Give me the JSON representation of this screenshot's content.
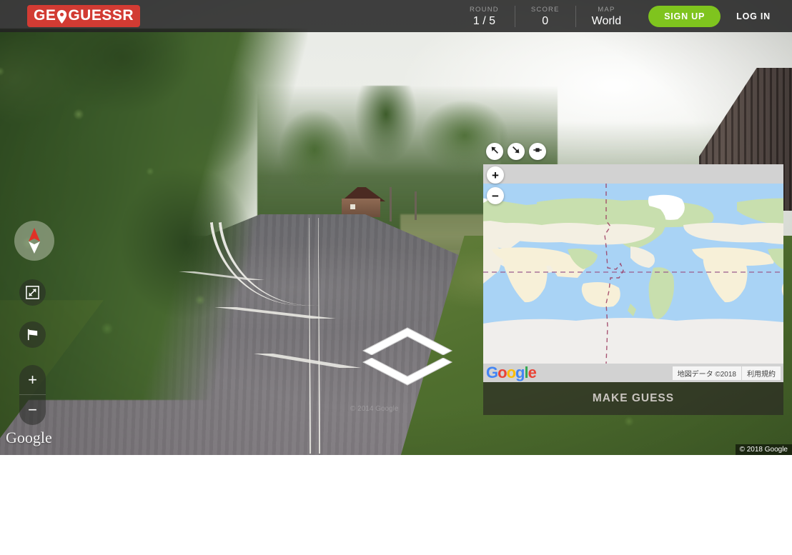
{
  "header": {
    "logo_text_left": "GE",
    "logo_text_right": "GUESSR",
    "logo_pin_icon": "map-pin-icon",
    "brand_color": "#d23b33",
    "stats": [
      {
        "key": "ROUND",
        "value": "1 / 5"
      },
      {
        "key": "SCORE",
        "value": "0"
      },
      {
        "key": "MAP",
        "value": "World"
      }
    ],
    "signup_label": "SIGN UP",
    "signup_color": "#7fc41e",
    "login_label": "LOG IN"
  },
  "streetview": {
    "compass_icon": "compass-needle-icon",
    "fullscreen_icon": "expand-arrows-icon",
    "flag_icon": "flag-icon",
    "zoom_in_label": "+",
    "zoom_out_label": "−",
    "forward_arrow_icon": "chevron-forward-icon",
    "google_watermark": "Google",
    "imagery_date": "© 2014 Google",
    "copyright": "© 2018 Google"
  },
  "minimap": {
    "buttons": [
      {
        "icon": "arrow-up-left-icon",
        "name": "shrink-map-button"
      },
      {
        "icon": "arrow-down-right-icon",
        "name": "enlarge-map-button"
      },
      {
        "icon": "pin-marker-icon",
        "name": "pin-toggle-button"
      }
    ],
    "zoom_in_label": "+",
    "zoom_out_label": "−",
    "google_logo_letters": [
      "G",
      "o",
      "o",
      "g",
      "l",
      "e"
    ],
    "attribution_data": "地図データ ©2018",
    "attribution_terms": "利用規約",
    "make_guess_label": "MAKE GUESS",
    "sea_color": "#a9d3f5",
    "land_color": "#f3efe2",
    "green_color": "#c8dfae",
    "ice_color": "#ffffff",
    "graticule_color": "#9b5e8f"
  }
}
